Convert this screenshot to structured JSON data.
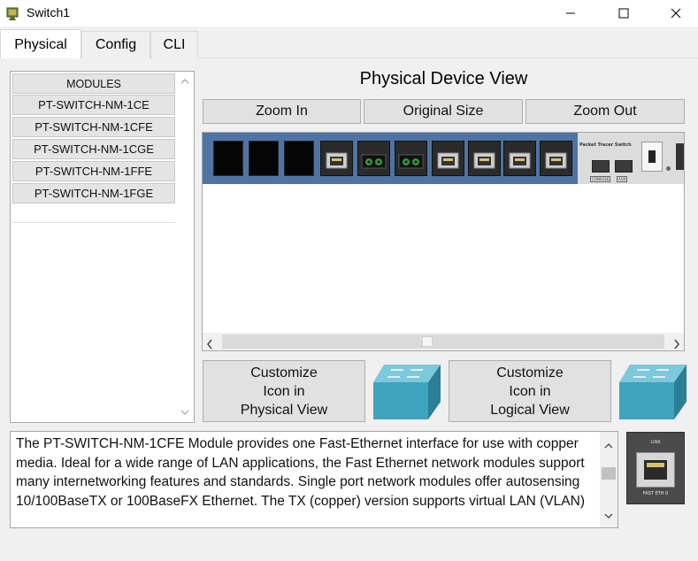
{
  "window": {
    "title": "Switch1",
    "controls": {
      "minimize": "minimize-icon",
      "maximize": "maximize-icon",
      "close": "close-icon"
    }
  },
  "tabs": [
    {
      "label": "Physical",
      "active": true
    },
    {
      "label": "Config",
      "active": false
    },
    {
      "label": "CLI",
      "active": false
    }
  ],
  "modules": {
    "header": "MODULES",
    "items": [
      "PT-SWITCH-NM-1CE",
      "PT-SWITCH-NM-1CFE",
      "PT-SWITCH-NM-1CGE",
      "PT-SWITCH-NM-1FFE",
      "PT-SWITCH-NM-1FGE"
    ]
  },
  "physical_view": {
    "title": "Physical Device View",
    "zoom_in": "Zoom In",
    "original_size": "Original Size",
    "zoom_out": "Zoom Out",
    "device_label": "Packet Tracer Switch",
    "console_label": "CONSOLE",
    "aux_label": "AUX",
    "accent_color": "#4e74a5"
  },
  "customize": {
    "physical_line1": "Customize",
    "physical_line2": "Icon in",
    "physical_line3": "Physical View",
    "logical_line1": "Customize",
    "logical_line2": "Icon in",
    "logical_line3": "Logical View",
    "icon_color": "#3fa3bd"
  },
  "description": {
    "text": "The PT-SWITCH-NM-1CFE Module provides one Fast-Ethernet interface for use with copper media. Ideal for a wide range of LAN applications, the Fast Ethernet network modules support many internetworking features and standards. Single port network modules offer autosensing 10/100BaseTX or 100BaseFX Ethernet. The TX (copper) version supports virtual LAN (VLAN)"
  },
  "port_preview": {
    "top_label": "LINK",
    "bottom_label": "FAST ETH 0"
  }
}
